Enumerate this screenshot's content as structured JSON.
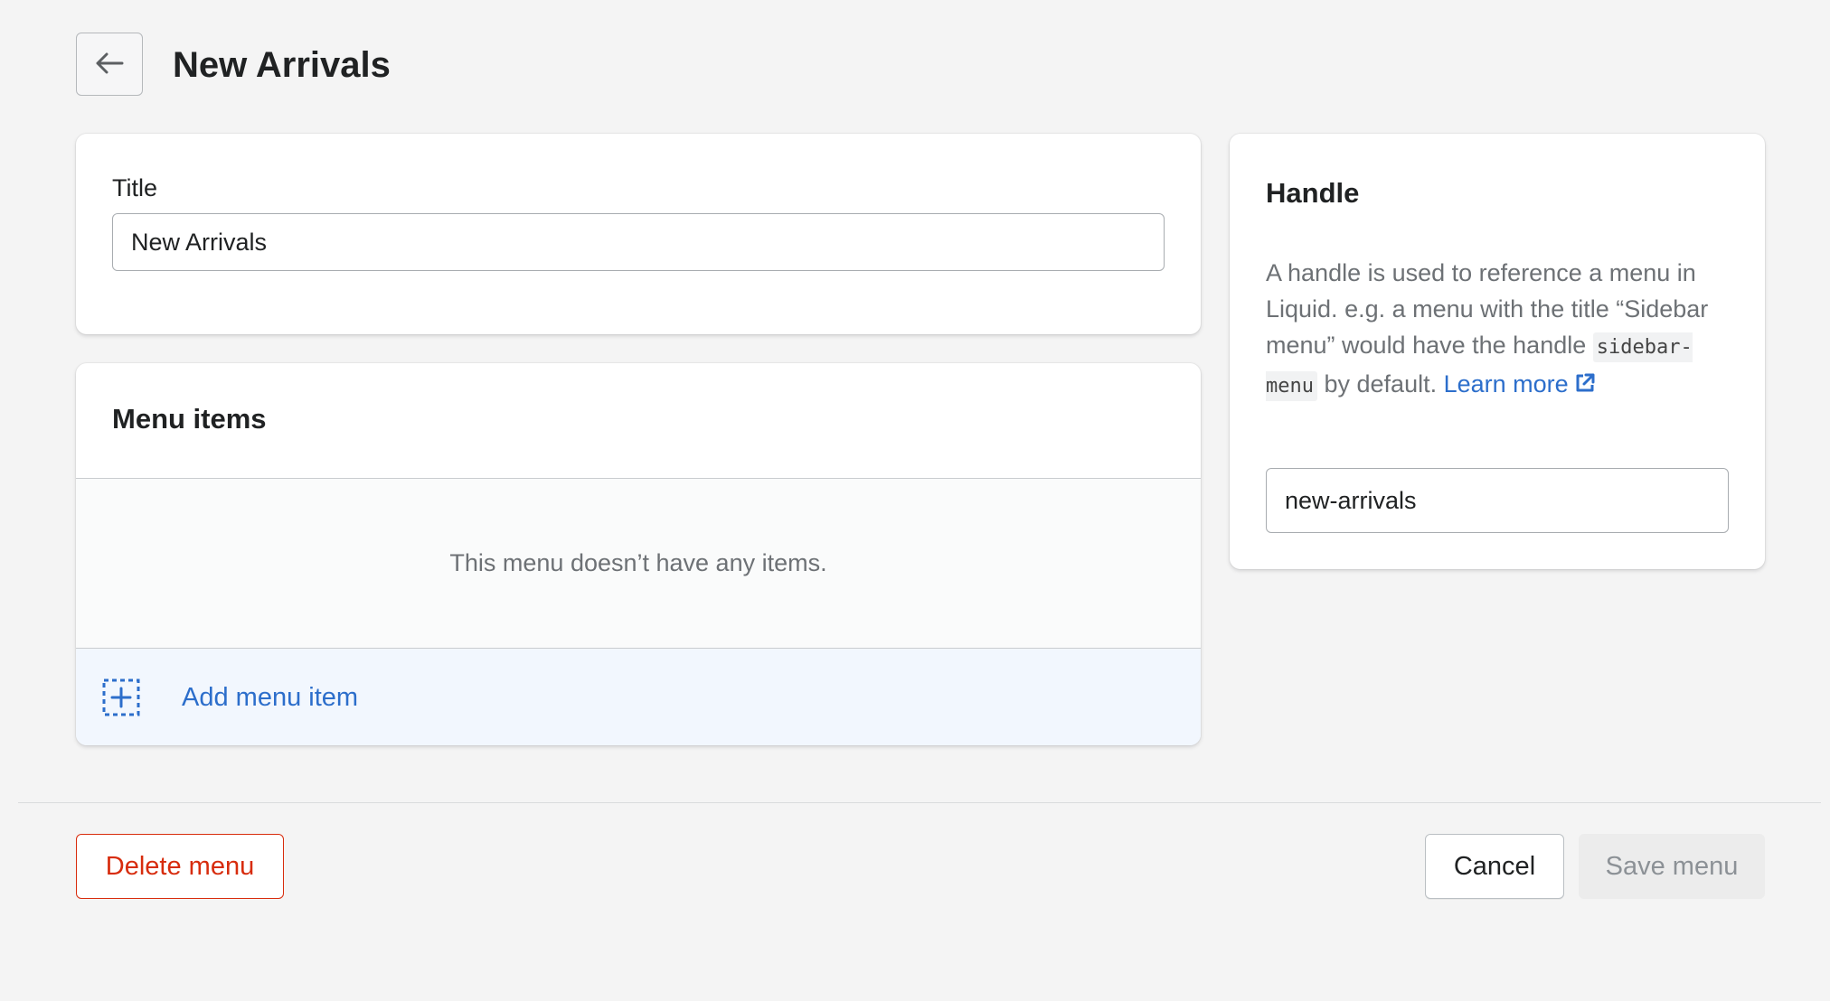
{
  "header": {
    "back_icon": "arrow-left-icon",
    "title": "New Arrivals"
  },
  "title_card": {
    "label": "Title",
    "value": "New Arrivals"
  },
  "menu_items": {
    "heading": "Menu items",
    "empty_text": "This menu doesn’t have any items.",
    "add_label": "Add menu item",
    "add_icon": "add-dashed-square-icon"
  },
  "handle": {
    "heading": "Handle",
    "desc_part1": "A handle is used to reference a menu in Liquid. e.g. a menu with the title “Sidebar menu” would have the handle",
    "code": "sidebar-menu",
    "desc_part2": "by default.",
    "link_text": "Learn more",
    "link_icon": "external-link-icon",
    "value": "new-arrivals"
  },
  "footer": {
    "delete_label": "Delete menu",
    "cancel_label": "Cancel",
    "save_label": "Save menu"
  },
  "colors": {
    "background": "#f4f4f4",
    "link": "#2c6ecb",
    "critical": "#d72c0d",
    "disabled_bg": "#ececec"
  }
}
